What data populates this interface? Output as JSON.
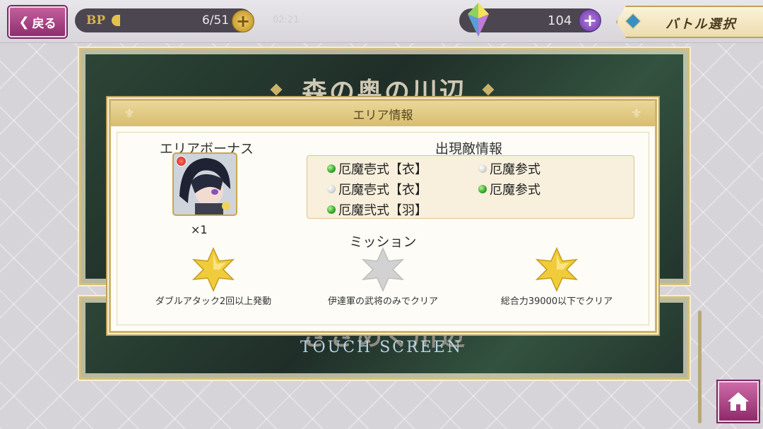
{
  "header": {
    "back_label": "戻る",
    "bp_label": "BP",
    "bp_value": "6/51",
    "bp_fill": 0.12,
    "bp_timer": "02:21",
    "gem_value": "104",
    "battle_select_label": "バトル選択"
  },
  "stages": {
    "stage1_title": "森の奥の川辺",
    "stage2_title": "ささめく川辺",
    "touch_label": "TOUCH SCREEN"
  },
  "modal": {
    "title": "エリア情報",
    "bonus_title": "エリアボーナス",
    "bonus_count": "×1",
    "enemy_title": "出現敵情報",
    "enemies": [
      {
        "name": "厄魔壱式【衣】",
        "status": "green"
      },
      {
        "name": "厄魔参式",
        "status": "gray"
      },
      {
        "name": "厄魔壱式【衣】",
        "status": "gray"
      },
      {
        "name": "厄魔参式",
        "status": "green"
      },
      {
        "name": "厄魔弐式【羽】",
        "status": "green"
      }
    ],
    "mission_title": "ミッション",
    "missions": [
      {
        "text": "ダブルアタック2回以上発動",
        "achieved": true
      },
      {
        "text": "伊達軍の武将のみでクリア",
        "achieved": false
      },
      {
        "text": "総合力39000以下でクリア",
        "achieved": true
      }
    ]
  },
  "colors": {
    "accent_gold": "#cdb46a",
    "button_pink": "#a8417f",
    "star_gold": "#f0cc3a",
    "star_gray": "#d2d2d2"
  },
  "icons": [
    "chevron-left-icon",
    "plus-icon",
    "gem-icon",
    "diamond-icon",
    "star-icon",
    "home-icon",
    "fleur-icon"
  ]
}
